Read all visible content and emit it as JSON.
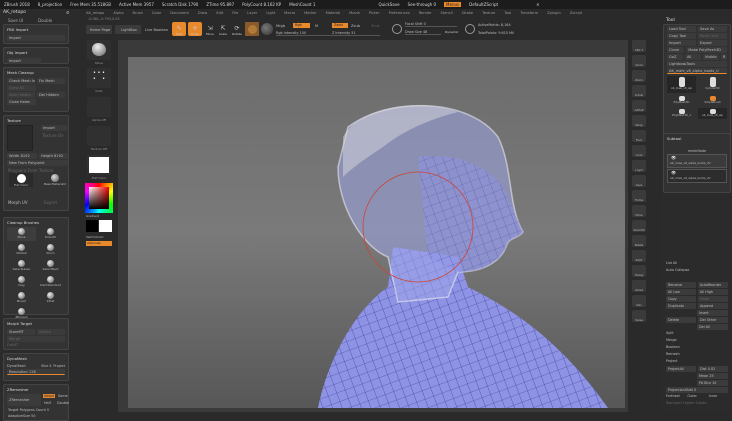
{
  "titlebar": {
    "app": "ZBrush 2018",
    "doc": "8_projection",
    "free_mem": "Free Mem 35.518GB",
    "active_mem": "Active Mem 3957",
    "scratch": "Scratch Disk 1790",
    "ztime": "ZTime 95.897",
    "polycount": "PolyCount 8.162 KP",
    "meshcount": "MeshCount 1",
    "quicksave": "QuickSave",
    "seethrough": "See-through 0",
    "menus_btn": "Menus",
    "script": "DefaultZScript"
  },
  "menus": [
    "AK_retopo",
    "Alpha",
    "Brush",
    "Color",
    "Document",
    "Draw",
    "Edit",
    "File",
    "Layer",
    "Light",
    "Macro",
    "Marker",
    "Material",
    "Movie",
    "Picker",
    "Preferences",
    "Render",
    "Stencil",
    "Stroke",
    "Texture",
    "Tool",
    "Transform",
    "Zplugin",
    "Zscript"
  ],
  "coords": "-0.081,-0.793,0.03",
  "toolbar": {
    "home": "Home Page",
    "lightbox": "LightBox",
    "live_boolean": "Live Boolean",
    "edit": "Edit",
    "draw": "Draw",
    "move": "Move",
    "scale": "Scale",
    "rotate": "Rotate",
    "mrgb": "Mrgb",
    "rgb": "Rgb",
    "m": "M",
    "zadd": "Zadd",
    "zsub": "Zsub",
    "zcut": "Zcut",
    "rgb_intensity": "Rgb Intensity 100",
    "z_intensity": "Z Intensity 51",
    "focal_shift": "Focal Shift 0",
    "draw_size": "Draw Size 48",
    "dynamic": "Dynamic",
    "active_points": "ActivePoints: 8,164",
    "total_points": "TotalPoints: 9.615 Mil"
  },
  "left_panel": {
    "title": "AK_retopo",
    "save_ui": "Save UI",
    "double": "Double",
    "fbx": {
      "title": "FBX Import",
      "import": "Import"
    },
    "obj": {
      "title": "Obj Import",
      "import": "Import"
    },
    "mesh_cleanup": {
      "title": "Mesh Cleanup",
      "check": "Check Mesh In",
      "fix": "Fix Mesh",
      "grow_all": "Grow All",
      "split_hidden": "Split Hidden",
      "del_hidden": "Del Hidden",
      "close_holes": "Close Holes"
    },
    "texture": {
      "title": "Texture",
      "import": "Import",
      "texture_on": "Texture On",
      "width": "Width 8192",
      "height": "Height 8192",
      "new_from_polypaint": "New From Polypaint",
      "polypaint_from_texture": "Polypaint From Texture",
      "flat_color": "Flat Color",
      "basic_material": "BasicMaterial2",
      "morph_uv": "Morph UV",
      "export": "Export"
    },
    "cleanup_brushes": {
      "title": "Cleanup Brushes",
      "items": [
        "Move",
        "Smooth",
        "hPolish",
        "Pinch",
        "SelectLasso",
        "SelectRect",
        "Clay",
        "DamStandard",
        "Morph",
        "Inflat",
        "ZProject"
      ]
    },
    "morph_target": {
      "title": "Morph Target",
      "store": "StoreMT",
      "switch": "Switch",
      "morph": "Morph",
      "delmt": "DelMT"
    },
    "dynamesh": {
      "title": "DynaMesh",
      "dynamesh": "DynaMesh",
      "blur": "Blur 4",
      "project": "Project",
      "resolution": "Resolution 128"
    },
    "zremesher": {
      "title": "ZRemesher",
      "zremesher": "ZRemesher",
      "adapt": "Adapt",
      "same": "Same",
      "half": "Half",
      "double": "Double",
      "target": "Target Polygons Count 5",
      "adaptive_size": "AdaptiveSize 50"
    }
  },
  "left_shelf": {
    "brush": "Move",
    "stroke": "Dots",
    "alpha": "Alpha Off",
    "texture": "Texture Off",
    "material": "Flat Color",
    "gradient": "Gradient",
    "switch_color": "SwitchColor",
    "alternate": "Alternate"
  },
  "right_shelf": [
    "SPix 3",
    "Scroll",
    "Zoom",
    "Actual",
    "AAHalf",
    "Persp",
    "Floor",
    "Local",
    "L.Sym",
    "Gxyz",
    "Frame",
    "Move",
    "Zoom3D",
    "Rotate",
    "PolyF",
    "Transp",
    "Ghost",
    "Solo",
    "Xpose"
  ],
  "tool_panel": {
    "title": "Tool",
    "load": "Load Tool",
    "save_as": "Save As",
    "copy": "Copy Tool",
    "paste": "Paste Tool",
    "import": "Import",
    "export": "Export",
    "clone": "Clone",
    "make_polymesh": "Make PolyMesh3D",
    "goz": "GoZ",
    "all": "All",
    "visible": "Visible",
    "r": "R",
    "lightbox_tools": "Lightbox▸Tools",
    "current_tool": "AK_male_v8_alpha_boots_U",
    "tools": [
      "AK_male_v8_alp",
      "Cylinder3D",
      "PolyMesh3D",
      "SimpleBrush",
      "PolyMesh3D_1",
      "AK_male_v8_alp"
    ],
    "subtool": {
      "title": "Subtool",
      "node": "meshNode",
      "items": [
        "AK_male_v8_alpha_boots_UV",
        "AK_male_v8_alpha_boots_UV"
      ]
    },
    "list_all": "List All",
    "auto_collapse": "Auto Collapse",
    "rename": "Rename",
    "autoreorder": "AutoReorder",
    "all_low": "All Low",
    "all_high": "All High",
    "copy2": "Copy",
    "paste2": "Paste",
    "duplicate": "Duplicate",
    "append": "Append",
    "insert": "Insert",
    "delete": "Delete",
    "del_other": "Del Other",
    "del_all": "Del All",
    "split": "Split",
    "merge": "Merge",
    "boolean": "Boolean",
    "remesh": "Remesh",
    "project": "Project",
    "project_all": "ProjectAll",
    "dist": "Dist 0.02",
    "mean": "Mean 25",
    "pa_blur": "PA Blur 10",
    "project_shell": "ProjectionShell 0",
    "farthest": "Farthest",
    "outer": "Outer",
    "inner": "Inner",
    "reproject": "Reproject Higher Subdiv"
  },
  "colors": {
    "accent": "#e8892c",
    "wire": "#7f86e0"
  }
}
